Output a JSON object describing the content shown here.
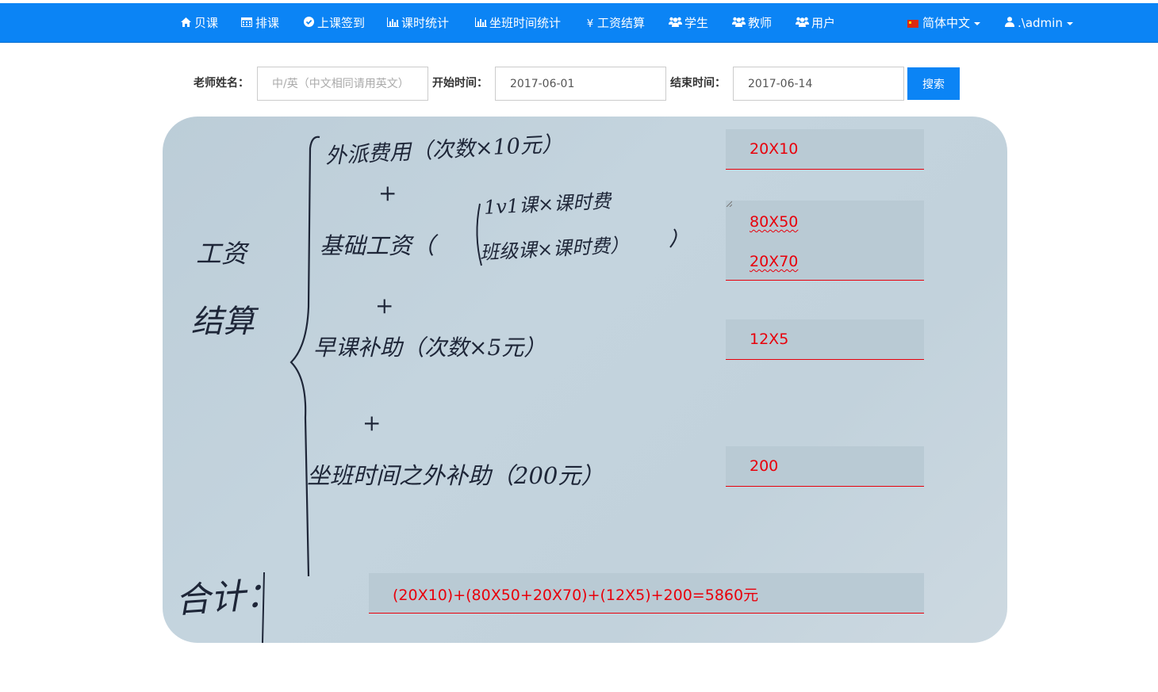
{
  "nav": {
    "items": [
      {
        "label": "贝课",
        "icon": "home-icon"
      },
      {
        "label": "排课",
        "icon": "calendar-icon"
      },
      {
        "label": "上课签到",
        "icon": "check-circle-icon"
      },
      {
        "label": "课时统计",
        "icon": "bar-chart-icon"
      },
      {
        "label": "坐班时间统计",
        "icon": "bar-chart-icon"
      },
      {
        "label": "工资结算",
        "icon": "yen-icon"
      },
      {
        "label": "学生",
        "icon": "users-icon"
      },
      {
        "label": "教师",
        "icon": "users-icon"
      },
      {
        "label": "用户",
        "icon": "users-icon"
      }
    ],
    "language": "简体中文",
    "user": ".\\admin"
  },
  "search": {
    "teacher_label": "老师姓名：",
    "teacher_placeholder": "中/英（中文相同请用英文）",
    "start_label": "开始时间：",
    "start_value": "2017-06-01",
    "end_label": "结束时间：",
    "end_value": "2017-06-14",
    "button": "搜索"
  },
  "note": {
    "left_title_1": "工资",
    "left_title_2": "结算",
    "line1": "外派费用（次数×10元）",
    "line2a": "1v1课×课时费",
    "line2_prefix": "基础工资（",
    "line2b": "班级课×课时费）",
    "line3": "早课补助（次数×5元）",
    "line4": "坐班时间之外补助（200元）",
    "total_label": "合计：",
    "plus": "+"
  },
  "fields": {
    "f1": "20X10",
    "f2a": "80X50",
    "f2b": "20X70",
    "f3": "12X5",
    "f4": "200",
    "total": "(20X10)+(80X50+20X70)+(12X5)+200=5860元"
  },
  "colors": {
    "nav_bg": "#0b84f5",
    "answer_red": "#e8000b"
  }
}
